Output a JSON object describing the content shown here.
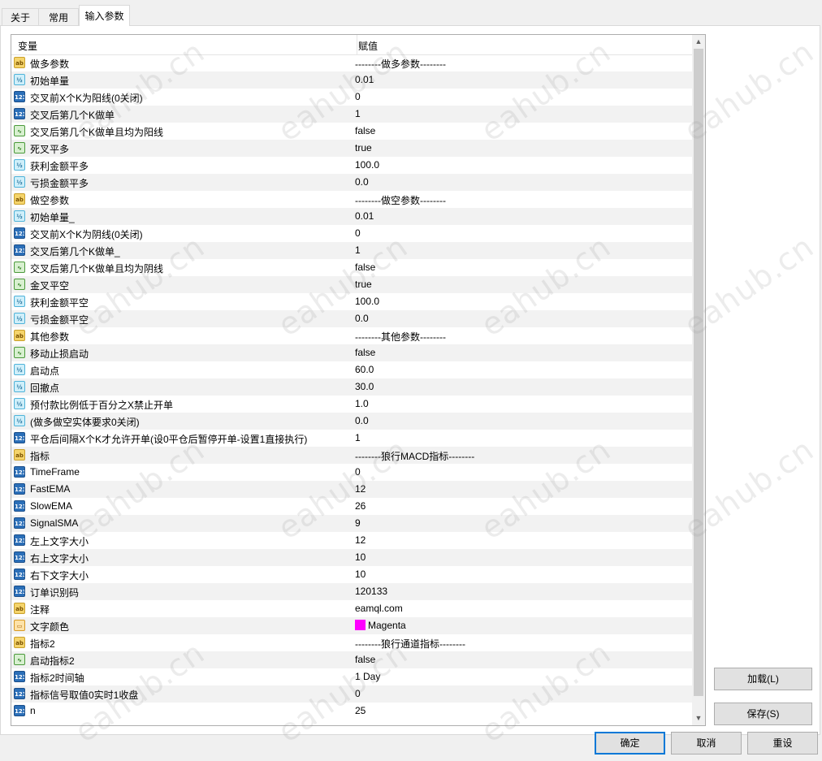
{
  "tabs": [
    "关于",
    "常用",
    "输入参数"
  ],
  "grid": {
    "header": {
      "variable": "变量",
      "value": "赋值"
    },
    "rows": [
      {
        "type": "str",
        "name": "做多参数",
        "value": "--------做多参数--------"
      },
      {
        "type": "dbl",
        "name": "初始单量",
        "value": "0.01"
      },
      {
        "type": "int",
        "name": "交叉前X个K为阳线(0关闭)",
        "value": "0"
      },
      {
        "type": "int",
        "name": "交叉后第几个K做单",
        "value": "1"
      },
      {
        "type": "bool",
        "name": "交叉后第几个K做单且均为阳线",
        "value": "false"
      },
      {
        "type": "bool",
        "name": "死叉平多",
        "value": "true"
      },
      {
        "type": "dbl",
        "name": "获利金额平多",
        "value": "100.0"
      },
      {
        "type": "dbl",
        "name": "亏损金额平多",
        "value": "0.0"
      },
      {
        "type": "str",
        "name": "做空参数",
        "value": "--------做空参数--------"
      },
      {
        "type": "dbl",
        "name": "初始单量_",
        "value": "0.01"
      },
      {
        "type": "int",
        "name": "交叉前X个K为阴线(0关闭)",
        "value": "0"
      },
      {
        "type": "int",
        "name": "交叉后第几个K做单_",
        "value": "1"
      },
      {
        "type": "bool",
        "name": "交叉后第几个K做单且均为阴线",
        "value": "false"
      },
      {
        "type": "bool",
        "name": "金叉平空",
        "value": "true"
      },
      {
        "type": "dbl",
        "name": "获利金额平空",
        "value": "100.0"
      },
      {
        "type": "dbl",
        "name": "亏损金额平空",
        "value": "0.0"
      },
      {
        "type": "str",
        "name": "其他参数",
        "value": "--------其他参数--------"
      },
      {
        "type": "bool",
        "name": "移动止损启动",
        "value": "false"
      },
      {
        "type": "dbl",
        "name": "启动点",
        "value": "60.0"
      },
      {
        "type": "dbl",
        "name": "回撤点",
        "value": "30.0"
      },
      {
        "type": "dbl",
        "name": "预付款比例低于百分之X禁止开单",
        "value": "1.0"
      },
      {
        "type": "dbl",
        "name": "(做多做空实体要求0关闭)",
        "value": "0.0"
      },
      {
        "type": "int",
        "name": "平仓后间隔X个K才允许开单(设0平仓后暂停开单-设置1直接执行)",
        "value": "1"
      },
      {
        "type": "str",
        "name": "指标",
        "value": "--------狼行MACD指标--------"
      },
      {
        "type": "int",
        "name": "TimeFrame",
        "value": "0"
      },
      {
        "type": "int",
        "name": "FastEMA",
        "value": "12"
      },
      {
        "type": "int",
        "name": "SlowEMA",
        "value": "26"
      },
      {
        "type": "int",
        "name": "SignalSMA",
        "value": "9"
      },
      {
        "type": "int",
        "name": "左上文字大小",
        "value": "12"
      },
      {
        "type": "int",
        "name": "右上文字大小",
        "value": "10"
      },
      {
        "type": "int",
        "name": "右下文字大小",
        "value": "10"
      },
      {
        "type": "int",
        "name": "订单识别码",
        "value": "120133"
      },
      {
        "type": "str",
        "name": "注释",
        "value": "eamql.com"
      },
      {
        "type": "clr",
        "name": "文字颜色",
        "value": "Magenta",
        "swatch": "#ff00ff"
      },
      {
        "type": "str",
        "name": "指标2",
        "value": "--------狼行通道指标--------"
      },
      {
        "type": "bool",
        "name": "启动指标2",
        "value": "false"
      },
      {
        "type": "int",
        "name": "指标2时间轴",
        "value": "1 Day"
      },
      {
        "type": "int",
        "name": "指标信号取值0实时1收盘",
        "value": "0"
      },
      {
        "type": "int",
        "name": "n",
        "value": "25"
      }
    ]
  },
  "icons": {
    "str": "ab",
    "dbl": "½",
    "int": "123",
    "bool": "∿",
    "clr": "▭"
  },
  "buttons": {
    "load": "加载(L)",
    "save": "保存(S)",
    "ok": "确定",
    "cancel": "取消",
    "reset": "重设"
  },
  "watermark": "eahub.cn"
}
